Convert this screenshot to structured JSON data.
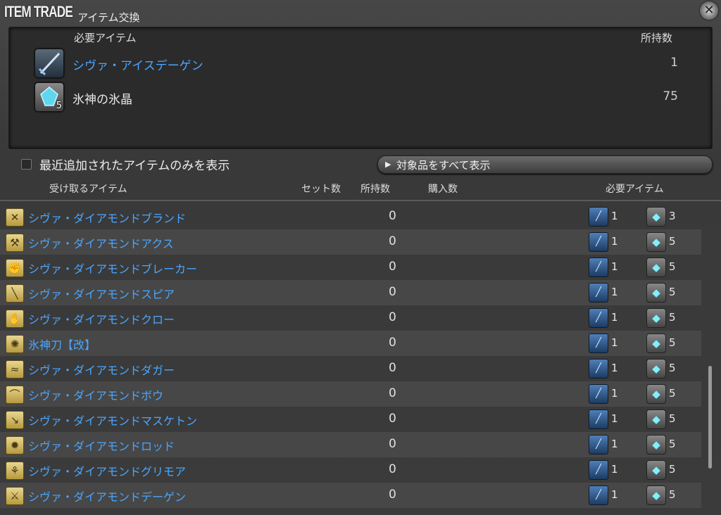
{
  "title": {
    "main": "ITEM TRADE",
    "sub": "アイテム交換"
  },
  "required_panel": {
    "header_item": "必要アイテム",
    "header_owned": "所持数",
    "items": [
      {
        "name": "シヴァ・アイスデーゲン",
        "owned": "1",
        "icon": "ice-sword-icon",
        "badge": ""
      },
      {
        "name": "氷神の氷晶",
        "owned": "75",
        "icon": "ice-crystal-icon",
        "badge": "5"
      }
    ]
  },
  "filter": {
    "checkbox_label": "最近追加されたアイテムのみを表示",
    "show_all_label": "対象品をすべて表示"
  },
  "columns": {
    "receive": "受け取るアイテム",
    "sets": "セット数",
    "owned": "所持数",
    "purchase": "購入数",
    "required": "必要アイテム"
  },
  "rows": [
    {
      "name": "シヴァ・ダイアモンドブランド",
      "owned": "0",
      "req1": "1",
      "req2": "3",
      "glyph": "✕"
    },
    {
      "name": "シヴァ・ダイアモンドアクス",
      "owned": "0",
      "req1": "1",
      "req2": "5",
      "glyph": "⚒"
    },
    {
      "name": "シヴァ・ダイアモンドブレーカー",
      "owned": "0",
      "req1": "1",
      "req2": "5",
      "glyph": "✊"
    },
    {
      "name": "シヴァ・ダイアモンドスピア",
      "owned": "0",
      "req1": "1",
      "req2": "5",
      "glyph": "╲"
    },
    {
      "name": "シヴァ・ダイアモンドクロー",
      "owned": "0",
      "req1": "1",
      "req2": "5",
      "glyph": "✋"
    },
    {
      "name": "氷神刀【改】",
      "owned": "0",
      "req1": "1",
      "req2": "5",
      "glyph": "✺"
    },
    {
      "name": "シヴァ・ダイアモンドダガー",
      "owned": "0",
      "req1": "1",
      "req2": "5",
      "glyph": "≈"
    },
    {
      "name": "シヴァ・ダイアモンドボウ",
      "owned": "0",
      "req1": "1",
      "req2": "5",
      "glyph": "⌒"
    },
    {
      "name": "シヴァ・ダイアモンドマスケトン",
      "owned": "0",
      "req1": "1",
      "req2": "5",
      "glyph": "↘"
    },
    {
      "name": "シヴァ・ダイアモンドロッド",
      "owned": "0",
      "req1": "1",
      "req2": "5",
      "glyph": "✹"
    },
    {
      "name": "シヴァ・ダイアモンドグリモア",
      "owned": "0",
      "req1": "1",
      "req2": "5",
      "glyph": "⚘"
    },
    {
      "name": "シヴァ・ダイアモンドデーゲン",
      "owned": "0",
      "req1": "1",
      "req2": "5",
      "glyph": "⚔"
    }
  ]
}
